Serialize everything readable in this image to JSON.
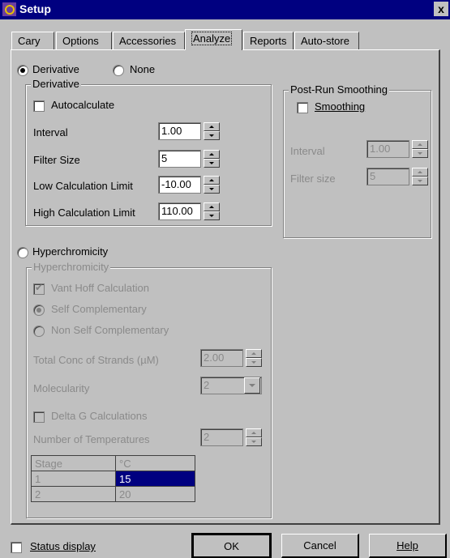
{
  "window": {
    "title": "Setup",
    "close_glyph": "x"
  },
  "tabs": [
    "Cary",
    "Options",
    "Accessories",
    "Analyze",
    "Reports",
    "Auto-store"
  ],
  "analysis_mode": {
    "derivative_label": "Derivative",
    "none_label": "None",
    "selected": "Derivative"
  },
  "derivative": {
    "group_label": "Derivative",
    "autocalculate_label": "Autocalculate",
    "autocalculate_checked": false,
    "interval_label": "Interval",
    "interval_value": "1.00",
    "filter_label": "Filter Size",
    "filter_value": "5",
    "low_label": "Low Calculation Limit",
    "low_value": "-10.00",
    "high_label": "High Calculation Limit",
    "high_value": "110.00"
  },
  "smoothing": {
    "group_label": "Post-Run Smoothing",
    "smoothing_label": "Smoothing",
    "smoothing_checked": false,
    "interval_label": "Interval",
    "interval_value": "1.00",
    "filter_label": "Filter size",
    "filter_value": "5"
  },
  "hyper": {
    "radio_label": "Hyperchromicity",
    "group_label": "Hyperchromicity",
    "vant_hoff_label": "Vant Hoff Calculation",
    "self_label": "Self Complementary",
    "nonself_label": "Non Self Complementary",
    "conc_label": "Total Conc of Strands (µM)",
    "conc_value": "2.00",
    "molecularity_label": "Molecularity",
    "molecularity_value": "2",
    "deltag_label": "Delta G Calculations",
    "numtemps_label": "Number of Temperatures",
    "numtemps_value": "2",
    "table": {
      "headers": [
        "Stage",
        "°C"
      ],
      "rows": [
        [
          "1",
          "15"
        ],
        [
          "2",
          "20"
        ]
      ]
    }
  },
  "footer": {
    "status_label": "Status display",
    "ok_label": "OK",
    "cancel_label": "Cancel",
    "help_label": "Help"
  }
}
